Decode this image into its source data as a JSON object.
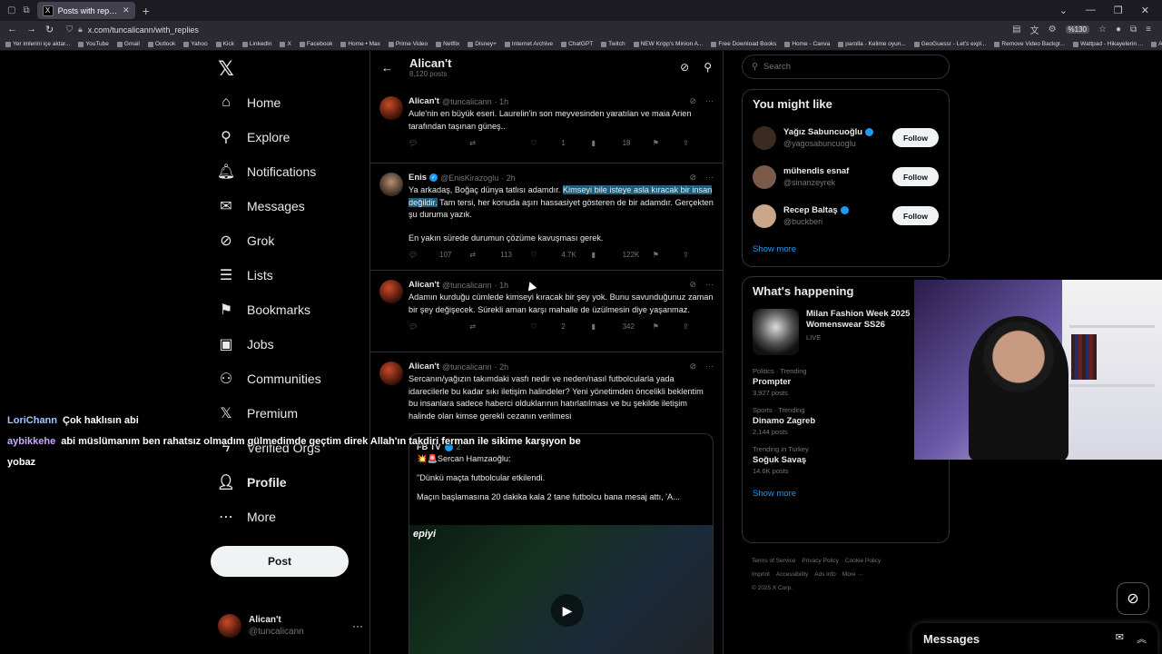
{
  "browser": {
    "tab_title": "Posts with replies by Alican't (@",
    "tab_favicon": "X",
    "url": "x.com/tuncalicann/with_replies",
    "zoom": "%130",
    "bookmarks": [
      "Yer imlerini içe aktar...",
      "YouTube",
      "Gmail",
      "Outlook",
      "Yahoo",
      "Kick",
      "LinkedIn",
      "X",
      "Facebook",
      "Home • Max",
      "Prime Video",
      "Netflix",
      "Disney+",
      "Internet Archive",
      "ChatGPT",
      "Twitch",
      "NEW Kripp's Minion A...",
      "Free Download Books",
      "Home - Canva",
      "parolla - Kelime oyun...",
      "GeoGuessr - Let's expl...",
      "Remove Video Backgr...",
      "Wattpad - Hikayelerin ...",
      "Anna's Archive: LibGe..."
    ]
  },
  "nav": {
    "logo": "𝕏",
    "items": [
      {
        "label": "Home",
        "icon": "⌂",
        "bold": false
      },
      {
        "label": "Explore",
        "icon": "⚲",
        "bold": false
      },
      {
        "label": "Notifications",
        "icon": "🔔︎",
        "bold": false
      },
      {
        "label": "Messages",
        "icon": "✉",
        "bold": false
      },
      {
        "label": "Grok",
        "icon": "⊘",
        "bold": false
      },
      {
        "label": "Lists",
        "icon": "☰",
        "bold": false
      },
      {
        "label": "Bookmarks",
        "icon": "⚑",
        "bold": false
      },
      {
        "label": "Jobs",
        "icon": "▣",
        "bold": false
      },
      {
        "label": "Communities",
        "icon": "⚇",
        "bold": false
      },
      {
        "label": "Premium",
        "icon": "𝕏",
        "bold": false
      },
      {
        "label": "Verified Orgs",
        "icon": "ϟ",
        "bold": false
      },
      {
        "label": "Profile",
        "icon": "👤︎",
        "bold": true
      },
      {
        "label": "More",
        "icon": "⋯",
        "bold": false
      }
    ],
    "post_label": "Post",
    "account": {
      "name": "Alican't",
      "handle": "@tuncalicann",
      "more": "···"
    }
  },
  "profile_header": {
    "back": "←",
    "name": "Alican't",
    "posts": "8,120 posts"
  },
  "tweets": [
    {
      "name": "Alican't",
      "handle": "@tuncalicann",
      "time": "· 1h",
      "verified": false,
      "text": "Aule'nin en büyük eseri. Laurelin'in son meyvesinden yaratılan ve maia Arien tarafından taşınan güneş..",
      "replies": "",
      "retweets": "",
      "likes": "1",
      "views": "18"
    },
    {
      "name": "Enis",
      "handle": "@EnisKirazoglu",
      "time": "· 2h",
      "verified": true,
      "text_before": "Ya arkadaş, Boğaç dünya tatlısı adamdır. ",
      "text_highlight": "Kimseyi bile isteye asla kıracak bir insan değildir.",
      "text_after": " Tam tersi, her konuda aşırı hassasiyet gösteren de bir adamdır. Gerçekten şu duruma yazık.",
      "text_p2": "En yakın sürede durumun çözüme kavuşması gerek.",
      "replies": "107",
      "retweets": "113",
      "likes": "4.7K",
      "views": "122K"
    },
    {
      "name": "Alican't",
      "handle": "@tuncalicann",
      "time": "· 1h",
      "verified": false,
      "text": "Adamın kurduğu cümlede kimseyi kıracak bir şey yok. Bunu savunduğunuz zaman bir şey değişecek. Sürekli aman karşı mahalle de üzülmesin diye yaşanmaz.",
      "replies": "",
      "retweets": "",
      "likes": "2",
      "views": "342"
    },
    {
      "name": "Alican't",
      "handle": "@tuncalicann",
      "time": "· 2h",
      "verified": false,
      "text": "Sercanın/yağızın takımdaki vasfı nedir ve neden/nasıl futbolcularla yada idarecilerle bu kadar sıkı iletişim halindeler? Yeni yönetimden öncelikli beklentim bu insanlara sadece haberci olduklarının hatırlatılması ve bu şekilde iletişim halinde olan kimse gerekli cezanın verilmesi",
      "quote": {
        "name": "FB TV",
        "time": "2",
        "line1": "💥🚨Sercan Hamzaoğlu:",
        "line2": "\"Dünkü maçta futbolcular etkilendi.",
        "line3": "Maçın başlamasına 20 dakika kala 2 tane futbolcu bana mesaj attı, 'A...",
        "media_brand": "epiyi",
        "play": "▶"
      }
    }
  ],
  "search": {
    "placeholder": "Search"
  },
  "you_might_like": {
    "title": "You might like",
    "people": [
      {
        "name": "Yağız Sabuncuoğlu",
        "handle": "@yagosabuncuoglu",
        "verified": true,
        "color": "#3a2a22"
      },
      {
        "name": "mühendis esnaf",
        "handle": "@sinanzeyrek",
        "verified": false,
        "color": "#7a5a4a"
      },
      {
        "name": "Recep Baltaş",
        "handle": "@buckberi",
        "verified": true,
        "color": "#c9a58a"
      }
    ],
    "follow_label": "Follow",
    "show_more": "Show more"
  },
  "whats_happening": {
    "title": "What's happening",
    "featured": {
      "title": "Milan Fashion Week 2025 Womenswear SS26",
      "label": "LIVE"
    },
    "trends": [
      {
        "context": "Politics · Trending",
        "name": "Prompter",
        "count": "3,927 posts"
      },
      {
        "context": "Sports · Trending",
        "name": "Dinamo Zagreb",
        "count": "2,144 posts"
      },
      {
        "context": "Trending in Turkey",
        "name": "Soğuk Savaş",
        "count": "14.6K posts"
      }
    ],
    "show_more": "Show more"
  },
  "footer": {
    "links": [
      "Terms of Service",
      "Privacy Policy",
      "Cookie Policy",
      "Imprint",
      "Accessibility",
      "Ads info",
      "More ···"
    ],
    "copyright": "© 2025 X Corp."
  },
  "chat": [
    {
      "user": "LoriChann",
      "message": "Çok haklısın abi"
    },
    {
      "user": "aybikkehe",
      "message": "abi müslümanım ben rahatsız olmadım gülmedimde geçtim direk Allah'ın takdiri ferman ile sikime karşıyon be yobaz"
    }
  ],
  "messages_drawer": {
    "title": "Messages"
  }
}
